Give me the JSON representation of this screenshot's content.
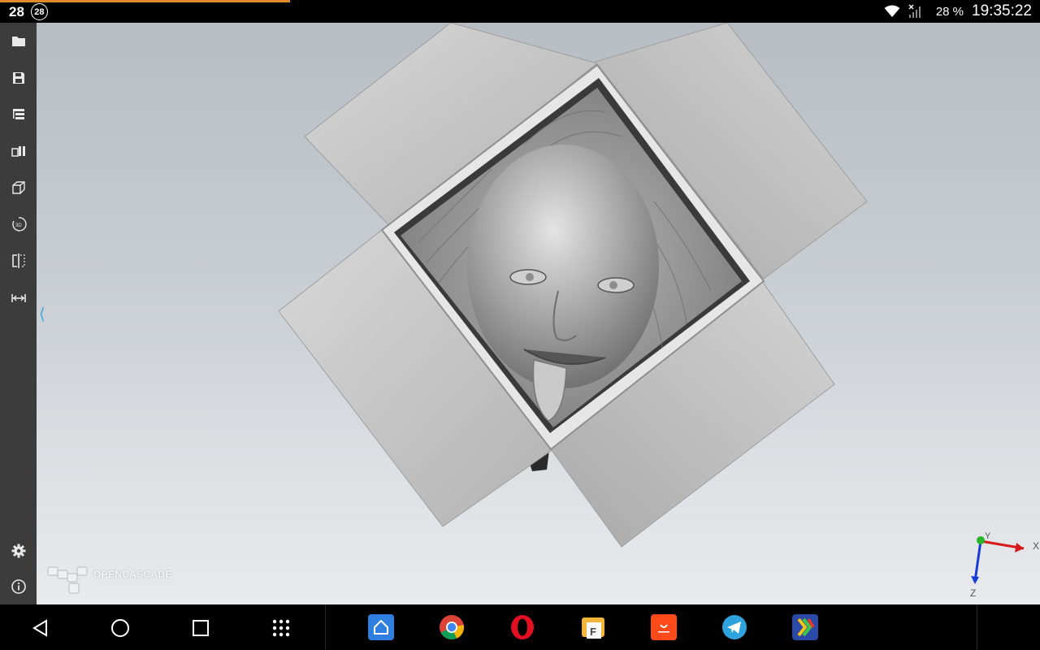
{
  "status_bar": {
    "notification_count": "28",
    "notification_badge": "28",
    "battery": "28 %",
    "time": "19:35:22",
    "progress_fraction": 0.28
  },
  "toolbar": {
    "items": [
      {
        "name": "open-file",
        "icon": "folder-icon"
      },
      {
        "name": "save",
        "icon": "save-icon"
      },
      {
        "name": "model-tree",
        "icon": "tree-icon"
      },
      {
        "name": "view-objects",
        "icon": "shapes-icon"
      },
      {
        "name": "view-projection",
        "icon": "cube-icon"
      },
      {
        "name": "rotate-3d",
        "icon": "rotate-3d-icon"
      },
      {
        "name": "section",
        "icon": "section-icon"
      },
      {
        "name": "measure",
        "icon": "measure-icon"
      }
    ],
    "bottom_items": [
      {
        "name": "settings",
        "icon": "gear-icon"
      },
      {
        "name": "about",
        "icon": "info-icon"
      }
    ]
  },
  "viewport": {
    "logo_text": "OPENCASCADE",
    "triad": {
      "x_label": "X",
      "y_label": "Y",
      "z_label": "Z"
    }
  },
  "nav_bar": {
    "buttons": [
      "back",
      "home",
      "recents",
      "apps"
    ],
    "apps": [
      {
        "name": "home-launcher",
        "color": "#2f7fe0"
      },
      {
        "name": "chrome",
        "color": "#ffffff"
      },
      {
        "name": "opera",
        "color": "#e01020"
      },
      {
        "name": "file-manager",
        "color": "#f2b43a"
      },
      {
        "name": "aliexpress",
        "color": "#ff4a1a"
      },
      {
        "name": "telegram",
        "color": "#2ea2dd"
      },
      {
        "name": "cad-assistant",
        "color": "#2b4aa8"
      }
    ]
  }
}
